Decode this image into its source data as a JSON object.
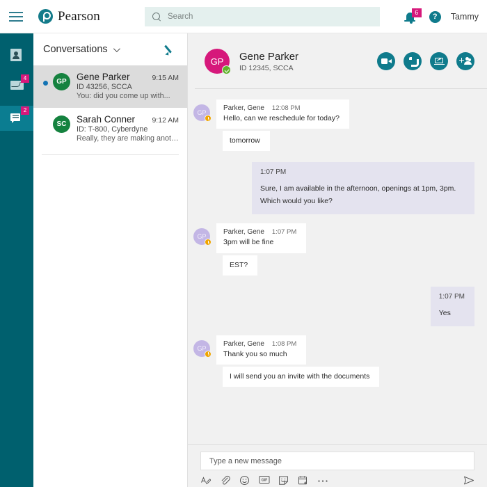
{
  "topbar": {
    "menu_icon": "hamburger-icon",
    "brand_name": "Pearson",
    "brand_mark": "pearson-logo",
    "search": {
      "placeholder": "Search",
      "value": "",
      "icon": "search-icon"
    },
    "notifications": {
      "icon": "bell-icon",
      "badge": "6",
      "badge_color": "#d6187b"
    },
    "help": {
      "icon": "help-icon",
      "glyph": "?"
    },
    "user": "Tammy"
  },
  "rail": {
    "items": [
      {
        "name": "contacts",
        "icon": "contact-card-icon",
        "badge": "",
        "active": false
      },
      {
        "name": "mail",
        "icon": "envelope-icon",
        "badge": "4",
        "active": false
      },
      {
        "name": "chat",
        "icon": "chat-bubbles-icon",
        "badge": "2",
        "active": true
      }
    ],
    "background": "#00606e",
    "active_background": "#0b7d91"
  },
  "conversations": {
    "title": "Conversations",
    "chevron": "chevron-down-icon",
    "compose_icon": "pencil-icon",
    "items": [
      {
        "initials": "GP",
        "name": "Gene Parker",
        "time": "9:15 AM",
        "subtitle": "ID 43256, SCCA",
        "preview": "You: did you come up with...",
        "unread": true,
        "selected": true,
        "avatar_color": "#15823f"
      },
      {
        "initials": "SC",
        "name": "Sarah Conner",
        "time": "9:12 AM",
        "subtitle": "ID: T-800, Cyberdyne",
        "preview": "Really, they are making another...",
        "unread": false,
        "selected": false,
        "avatar_color": "#15823f"
      }
    ]
  },
  "chat_header": {
    "initials": "GP",
    "name": "Gene Parker",
    "subtitle": "ID 12345, SCCA",
    "avatar_color": "#d6187b",
    "presence": "available",
    "actions": [
      {
        "name": "video-call-button",
        "icon": "video-camera-icon"
      },
      {
        "name": "audio-call-button",
        "icon": "phone-icon"
      },
      {
        "name": "screen-share-button",
        "icon": "screen-share-icon"
      },
      {
        "name": "add-participant-button",
        "icon": "add-person-icon"
      }
    ]
  },
  "messages": [
    {
      "direction": "in",
      "initials": "GP",
      "presence": "away",
      "sender": "Parker, Gene",
      "time": "12:08 PM",
      "bubbles": [
        "Hello, can we reschedule for today?",
        "tomorrow"
      ]
    },
    {
      "direction": "out",
      "time": "1:07 PM",
      "text": "Sure, I am available in the afternoon, openings at 1pm, 3pm. Which would you like?"
    },
    {
      "direction": "in",
      "initials": "GP",
      "presence": "away",
      "sender": "Parker, Gene",
      "time": "1:07 PM",
      "bubbles": [
        "3pm will be fine",
        "EST?"
      ]
    },
    {
      "direction": "out",
      "time": "1:07 PM",
      "text": "Yes"
    },
    {
      "direction": "in",
      "initials": "GP",
      "presence": "away",
      "sender": "Parker, Gene",
      "time": "1:08 PM",
      "bubbles": [
        "Thank you so much",
        "I will send you an invite with the documents"
      ]
    }
  ],
  "composer": {
    "placeholder": "Type a new message",
    "value": "",
    "tools": [
      {
        "name": "format-text-button",
        "icon": "format-text-icon"
      },
      {
        "name": "attach-file-button",
        "icon": "paperclip-icon"
      },
      {
        "name": "emoji-button",
        "icon": "smiley-icon"
      },
      {
        "name": "gif-button",
        "icon": "gif-icon"
      },
      {
        "name": "sticker-button",
        "icon": "sticker-icon"
      },
      {
        "name": "meeting-button",
        "icon": "calendar-icon"
      },
      {
        "name": "more-options-button",
        "icon": "ellipsis-icon"
      }
    ],
    "send": {
      "name": "send-button",
      "icon": "send-paper-plane-icon"
    }
  }
}
